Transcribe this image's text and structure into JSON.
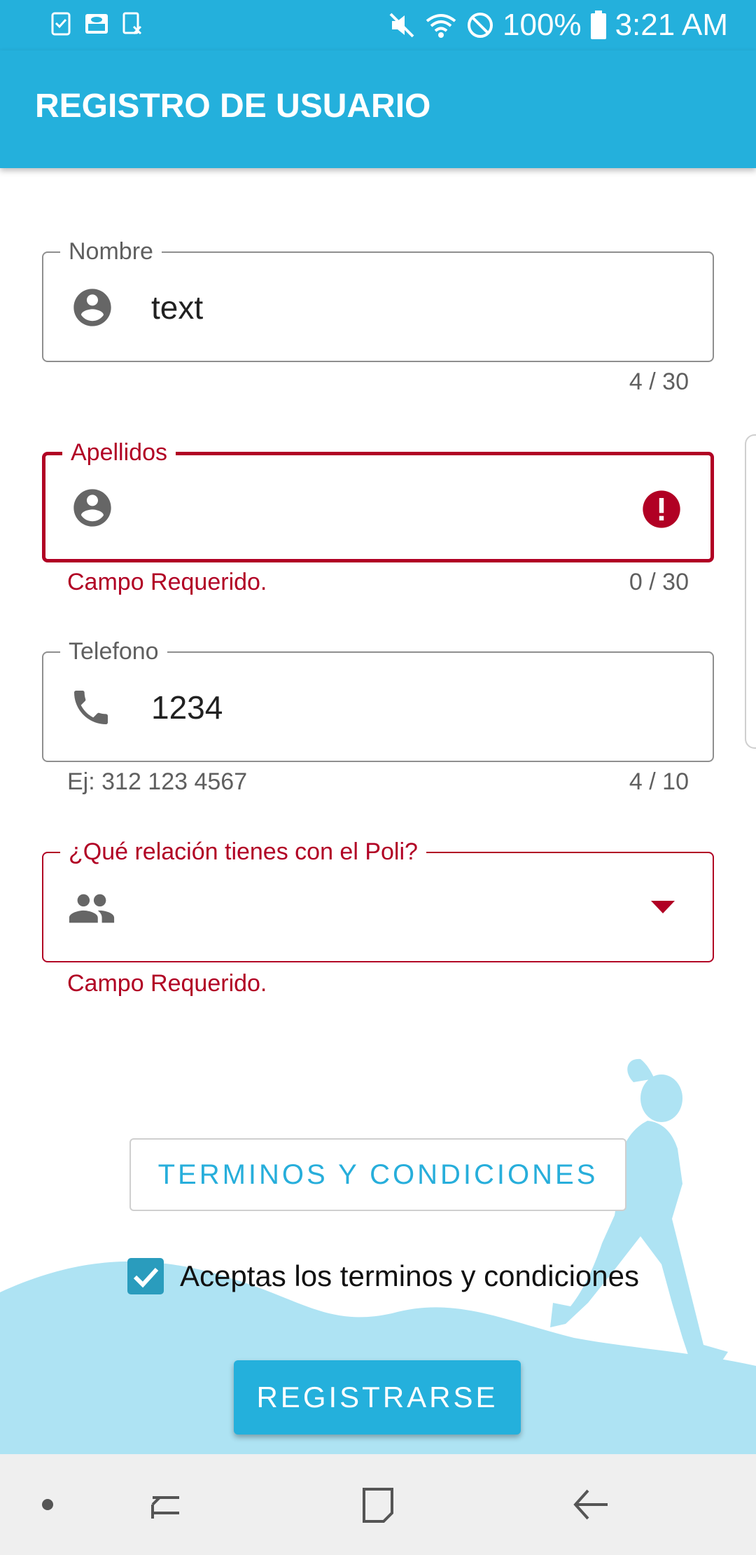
{
  "status_bar": {
    "icons_left": [
      "task-check-icon",
      "cloud-screen-icon",
      "sheet-close-icon"
    ],
    "icons_right": [
      "mute-icon",
      "wifi-icon",
      "block-icon",
      "battery-icon"
    ],
    "battery": "100%",
    "time": "3:21 AM"
  },
  "app_bar": {
    "title": "REGISTRO DE USUARIO"
  },
  "form": {
    "nombre": {
      "label": "Nombre",
      "value": "text",
      "counter": "4 / 30",
      "icon": "account-circle-icon"
    },
    "apellidos": {
      "label": "Apellidos",
      "value": "",
      "error": "Campo Requerido.",
      "counter": "0 / 30",
      "icon": "account-circle-icon",
      "error_icon": "error-icon"
    },
    "telefono": {
      "label": "Telefono",
      "value": "1234",
      "helper": "Ej: 312 123 4567",
      "counter": "4 / 10",
      "icon": "phone-icon"
    },
    "relacion": {
      "label": "¿Qué relación tienes con el Poli?",
      "value": "",
      "error": "Campo Requerido.",
      "icon": "people-icon",
      "dropdown_icon": "dropdown-arrow-icon"
    }
  },
  "terms_button": "TERMINOS Y CONDICIONES",
  "accept": {
    "label": "Aceptas los terminos y condiciones",
    "checked": true
  },
  "register_button": "REGISTRARSE",
  "nav_bar": [
    "dot-icon",
    "recents-icon",
    "home-icon",
    "back-icon"
  ],
  "colors": {
    "primary": "#24b0dc",
    "error": "#b10024",
    "checkbox": "#2a9cbd",
    "hill": "#aee3f3"
  }
}
